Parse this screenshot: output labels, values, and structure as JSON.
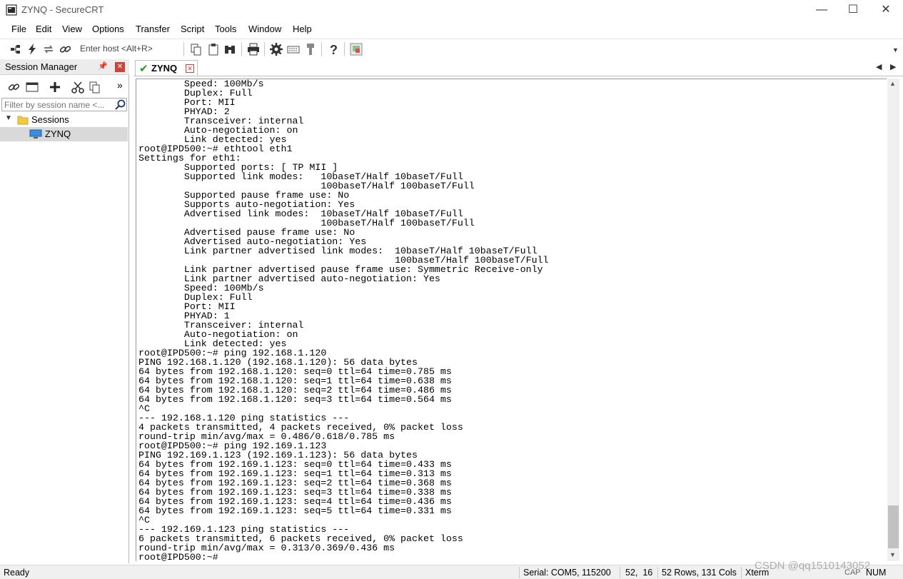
{
  "window": {
    "title": "ZYNQ - SecureCRT",
    "minimize": "—",
    "maximize": "☐",
    "close": "✕"
  },
  "menu": [
    "File",
    "Edit",
    "View",
    "Options",
    "Transfer",
    "Script",
    "Tools",
    "Window",
    "Help"
  ],
  "toolbar": {
    "host_placeholder": "Enter host <Alt+R>"
  },
  "session_manager": {
    "title": "Session Manager",
    "filter_placeholder": "Filter by session name <...",
    "folder": "Sessions",
    "session": "ZYNQ"
  },
  "tab": {
    "label": "ZYNQ"
  },
  "terminal": {
    "lines": [
      "        Speed: 100Mb/s",
      "        Duplex: Full",
      "        Port: MII",
      "        PHYAD: 2",
      "        Transceiver: internal",
      "        Auto-negotiation: on",
      "        Link detected: yes",
      "root@IPD500:~# ethtool eth1",
      "Settings for eth1:",
      "        Supported ports: [ TP MII ]",
      "        Supported link modes:   10baseT/Half 10baseT/Full",
      "                                100baseT/Half 100baseT/Full",
      "        Supported pause frame use: No",
      "        Supports auto-negotiation: Yes",
      "        Advertised link modes:  10baseT/Half 10baseT/Full",
      "                                100baseT/Half 100baseT/Full",
      "        Advertised pause frame use: No",
      "        Advertised auto-negotiation: Yes",
      "        Link partner advertised link modes:  10baseT/Half 10baseT/Full",
      "                                             100baseT/Half 100baseT/Full",
      "        Link partner advertised pause frame use: Symmetric Receive-only",
      "        Link partner advertised auto-negotiation: Yes",
      "        Speed: 100Mb/s",
      "        Duplex: Full",
      "        Port: MII",
      "        PHYAD: 1",
      "        Transceiver: internal",
      "        Auto-negotiation: on",
      "        Link detected: yes",
      "root@IPD500:~# ping 192.168.1.120",
      "PING 192.168.1.120 (192.168.1.120): 56 data bytes",
      "64 bytes from 192.168.1.120: seq=0 ttl=64 time=0.785 ms",
      "64 bytes from 192.168.1.120: seq=1 ttl=64 time=0.638 ms",
      "64 bytes from 192.168.1.120: seq=2 ttl=64 time=0.486 ms",
      "64 bytes from 192.168.1.120: seq=3 ttl=64 time=0.564 ms",
      "^C",
      "--- 192.168.1.120 ping statistics ---",
      "4 packets transmitted, 4 packets received, 0% packet loss",
      "round-trip min/avg/max = 0.486/0.618/0.785 ms",
      "root@IPD500:~# ping 192.169.1.123",
      "PING 192.169.1.123 (192.169.1.123): 56 data bytes",
      "64 bytes from 192.169.1.123: seq=0 ttl=64 time=0.433 ms",
      "64 bytes from 192.169.1.123: seq=1 ttl=64 time=0.313 ms",
      "64 bytes from 192.169.1.123: seq=2 ttl=64 time=0.368 ms",
      "64 bytes from 192.169.1.123: seq=3 ttl=64 time=0.338 ms",
      "64 bytes from 192.169.1.123: seq=4 ttl=64 time=0.436 ms",
      "64 bytes from 192.169.1.123: seq=5 ttl=64 time=0.331 ms",
      "^C",
      "--- 192.169.1.123 ping statistics ---",
      "6 packets transmitted, 6 packets received, 0% packet loss",
      "round-trip min/avg/max = 0.313/0.369/0.436 ms",
      "root@IPD500:~# "
    ]
  },
  "status": {
    "ready": "Ready",
    "serial": "Serial: COM5, 115200",
    "cursor": "52,  16",
    "size": "52 Rows, 131 Cols",
    "term": "Xterm",
    "cap": "CAP",
    "num": "NUM"
  },
  "watermark": "CSDN @qq1510143052",
  "colors": {
    "accent_green": "#1aa11a",
    "close_red": "#c9453a"
  }
}
